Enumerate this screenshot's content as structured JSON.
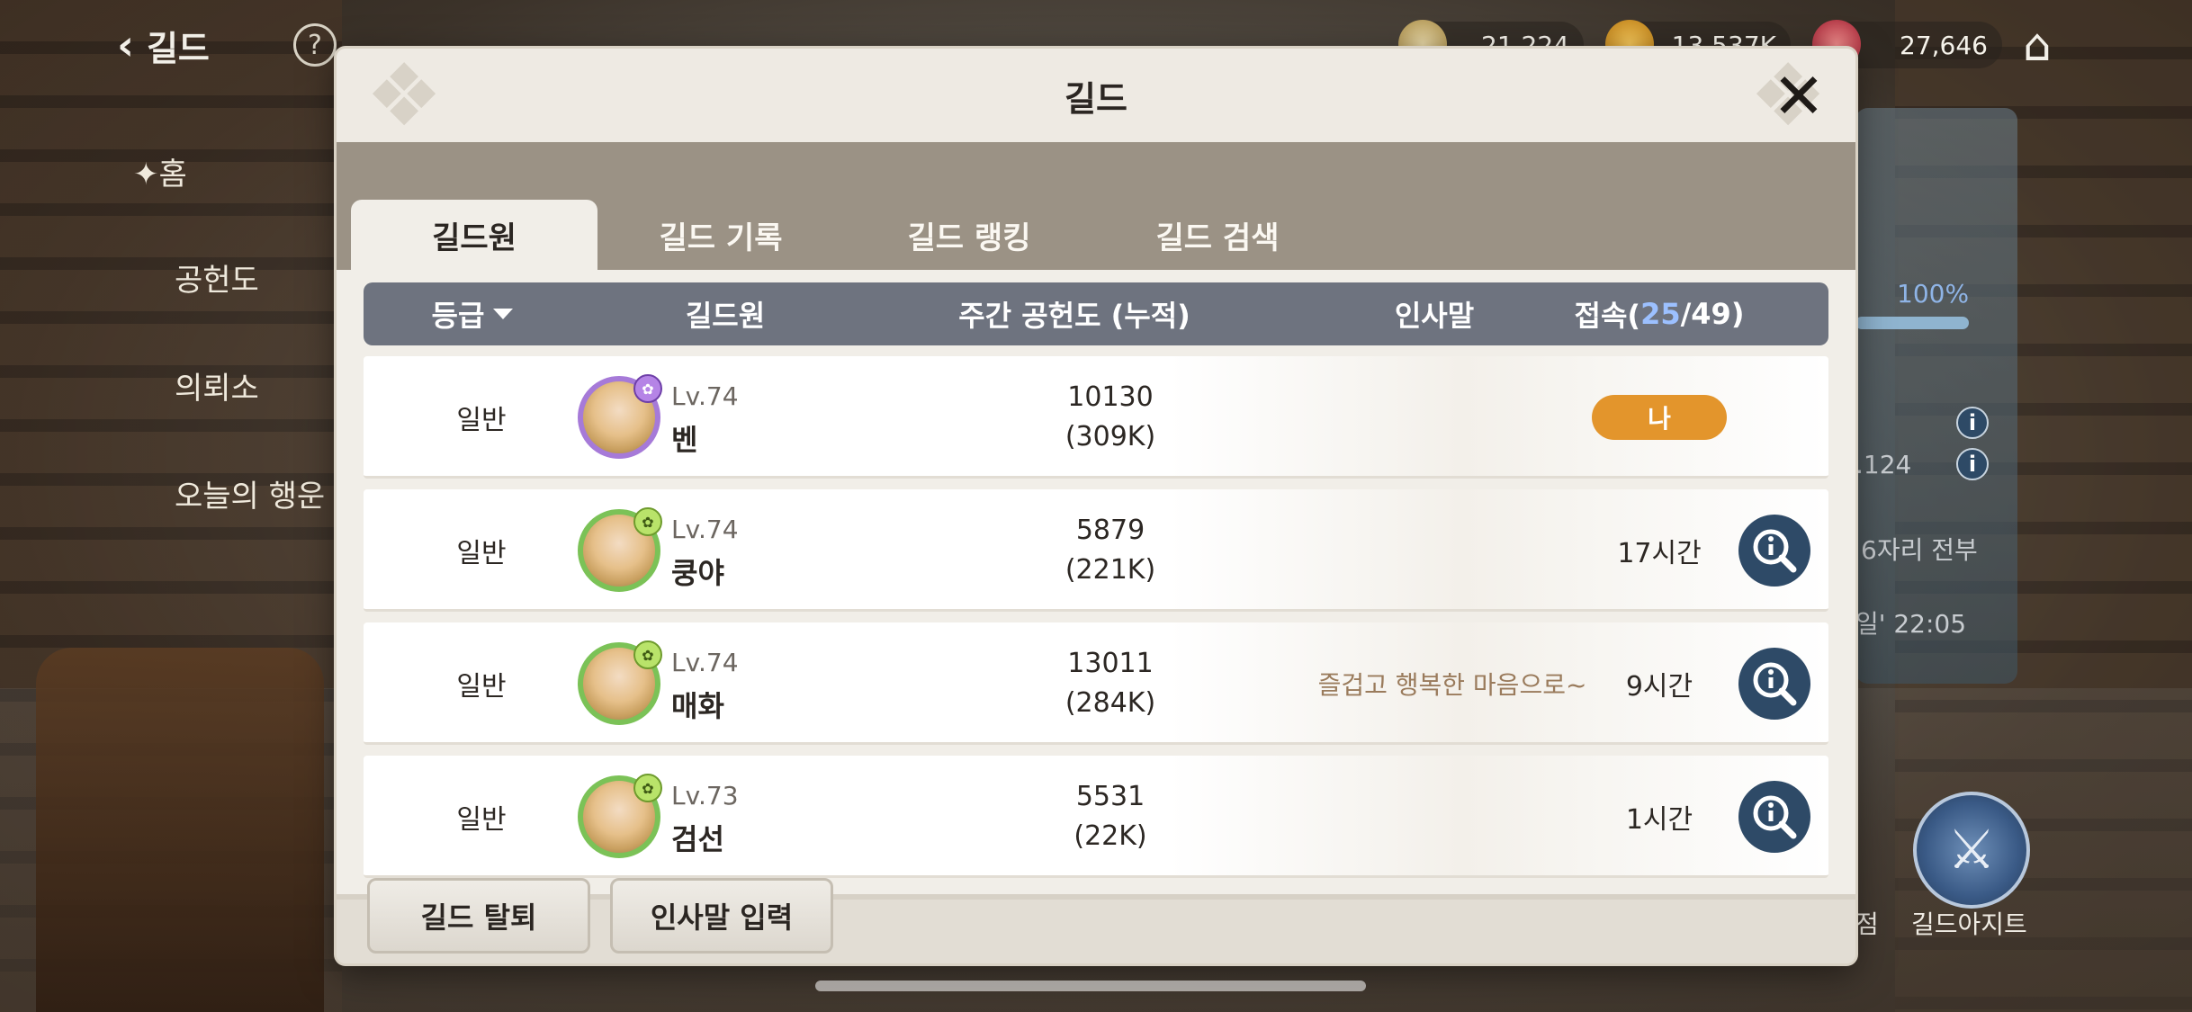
{
  "hud": {
    "back_label": "길드",
    "resources": [
      {
        "value": "21,224",
        "icon": "gem-icon",
        "color": "#c9a15a"
      },
      {
        "value": "13,537K",
        "icon": "gold-coin-icon",
        "color": "#e0a21e"
      },
      {
        "value": "27,646",
        "icon": "red-crystal-icon",
        "color": "#c83a4a"
      }
    ]
  },
  "side_menu": {
    "items": [
      "홈",
      "공헌도",
      "의뢰소",
      "오늘의 행운"
    ]
  },
  "right_panel": {
    "percent": "100%",
    "value_text": ".124",
    "note1": "6자리 전부",
    "note2": "일' 22:05",
    "shop_label": "점",
    "hideout_label": "길드아지트"
  },
  "modal": {
    "title": "길드",
    "tabs": [
      {
        "label": "길드원",
        "active": true
      },
      {
        "label": "길드 기록",
        "active": false
      },
      {
        "label": "길드 랭킹",
        "active": false
      },
      {
        "label": "길드 검색",
        "active": false
      }
    ],
    "columns": {
      "grade": "등급",
      "member": "길드원",
      "weekly": "주간 공헌도 (누적)",
      "greeting": "인사말",
      "access_prefix": "접속(",
      "access_online": "25",
      "access_suffix": "/49)"
    },
    "members": [
      {
        "grade": "일반",
        "level": "Lv.74",
        "name": "벤",
        "weekly": "10130",
        "total": "(309K)",
        "greeting": "",
        "access": "",
        "is_me": true,
        "me_label": "나",
        "frame": "purple"
      },
      {
        "grade": "일반",
        "level": "Lv.74",
        "name": "쿵야",
        "weekly": "5879",
        "total": "(221K)",
        "greeting": "",
        "access": "17시간",
        "is_me": false,
        "frame": "green"
      },
      {
        "grade": "일반",
        "level": "Lv.74",
        "name": "매화",
        "weekly": "13011",
        "total": "(284K)",
        "greeting": "즐겁고 행복한 마음으로~",
        "access": "9시간",
        "is_me": false,
        "frame": "green"
      },
      {
        "grade": "일반",
        "level": "Lv.73",
        "name": "검선",
        "weekly": "5531",
        "total": "(22K)",
        "greeting": "",
        "access": "1시간",
        "is_me": false,
        "frame": "green"
      }
    ],
    "footer": {
      "leave_label": "길드 탈퇴",
      "greeting_label": "인사말 입력"
    }
  }
}
